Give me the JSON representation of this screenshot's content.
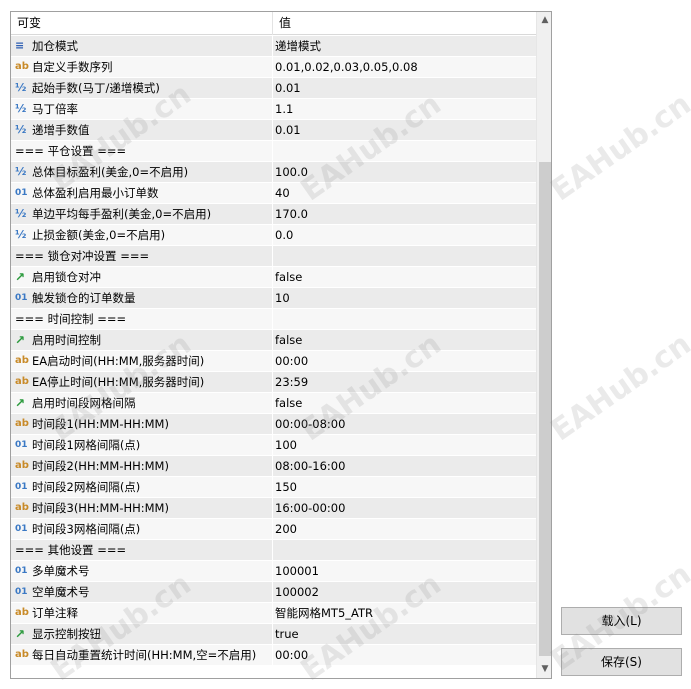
{
  "header": {
    "col_name": "可变",
    "col_value": "值"
  },
  "rows": [
    {
      "type": "enum",
      "icon": "enum-icon",
      "glyph": "≡",
      "name": "加仓模式",
      "value": "递增模式"
    },
    {
      "type": "ab",
      "icon": "string-icon",
      "glyph": "ab",
      "name": "自定义手数序列",
      "value": "0.01,0.02,0.03,0.05,0.08"
    },
    {
      "type": "half",
      "icon": "double-icon",
      "glyph": "½",
      "name": "起始手数(马丁/递增模式)",
      "value": "0.01"
    },
    {
      "type": "half",
      "icon": "double-icon",
      "glyph": "½",
      "name": "马丁倍率",
      "value": "1.1"
    },
    {
      "type": "half",
      "icon": "double-icon",
      "glyph": "½",
      "name": "递增手数值",
      "value": "0.01"
    },
    {
      "type": "section",
      "icon": "",
      "glyph": "",
      "name": "=== 平仓设置 ===",
      "value": ""
    },
    {
      "type": "half",
      "icon": "double-icon",
      "glyph": "½",
      "name": "总体目标盈利(美金,0=不启用)",
      "value": "100.0"
    },
    {
      "type": "int",
      "icon": "integer-icon",
      "glyph": "01",
      "name": "总体盈利启用最小订单数",
      "value": "40"
    },
    {
      "type": "half",
      "icon": "double-icon",
      "glyph": "½",
      "name": "单边平均每手盈利(美金,0=不启用)",
      "value": "170.0"
    },
    {
      "type": "half",
      "icon": "double-icon",
      "glyph": "½",
      "name": "止损金额(美金,0=不启用)",
      "value": "0.0"
    },
    {
      "type": "section",
      "icon": "",
      "glyph": "",
      "name": "=== 锁仓对冲设置 ===",
      "value": ""
    },
    {
      "type": "bool",
      "icon": "bool-icon",
      "glyph": "↗",
      "name": "启用锁仓对冲",
      "value": "false"
    },
    {
      "type": "int",
      "icon": "integer-icon",
      "glyph": "01",
      "name": "触发锁仓的订单数量",
      "value": "10"
    },
    {
      "type": "section",
      "icon": "",
      "glyph": "",
      "name": "=== 时间控制 ===",
      "value": ""
    },
    {
      "type": "bool",
      "icon": "bool-icon",
      "glyph": "↗",
      "name": "启用时间控制",
      "value": "false"
    },
    {
      "type": "ab",
      "icon": "string-icon",
      "glyph": "ab",
      "name": "EA启动时间(HH:MM,服务器时间)",
      "value": "00:00"
    },
    {
      "type": "ab",
      "icon": "string-icon",
      "glyph": "ab",
      "name": "EA停止时间(HH:MM,服务器时间)",
      "value": "23:59"
    },
    {
      "type": "bool",
      "icon": "bool-icon",
      "glyph": "↗",
      "name": "启用时间段网格间隔",
      "value": "false"
    },
    {
      "type": "ab",
      "icon": "string-icon",
      "glyph": "ab",
      "name": "时间段1(HH:MM-HH:MM)",
      "value": "00:00-08:00"
    },
    {
      "type": "int",
      "icon": "integer-icon",
      "glyph": "01",
      "name": "时间段1网格间隔(点)",
      "value": "100"
    },
    {
      "type": "ab",
      "icon": "string-icon",
      "glyph": "ab",
      "name": "时间段2(HH:MM-HH:MM)",
      "value": "08:00-16:00"
    },
    {
      "type": "int",
      "icon": "integer-icon",
      "glyph": "01",
      "name": "时间段2网格间隔(点)",
      "value": "150"
    },
    {
      "type": "ab",
      "icon": "string-icon",
      "glyph": "ab",
      "name": "时间段3(HH:MM-HH:MM)",
      "value": "16:00-00:00"
    },
    {
      "type": "int",
      "icon": "integer-icon",
      "glyph": "01",
      "name": "时间段3网格间隔(点)",
      "value": "200"
    },
    {
      "type": "section",
      "icon": "",
      "glyph": "",
      "name": "=== 其他设置 ===",
      "value": ""
    },
    {
      "type": "int",
      "icon": "integer-icon",
      "glyph": "01",
      "name": "多单魔术号",
      "value": "100001"
    },
    {
      "type": "int",
      "icon": "integer-icon",
      "glyph": "01",
      "name": "空单魔术号",
      "value": "100002"
    },
    {
      "type": "ab",
      "icon": "string-icon",
      "glyph": "ab",
      "name": "订单注释",
      "value": "智能网格MT5_ATR"
    },
    {
      "type": "bool",
      "icon": "bool-icon",
      "glyph": "↗",
      "name": "显示控制按钮",
      "value": "true"
    },
    {
      "type": "ab",
      "icon": "string-icon",
      "glyph": "ab",
      "name": "每日自动重置统计时间(HH:MM,空=不启用)",
      "value": "00:00"
    }
  ],
  "scrollbar": {
    "up_icon": "scroll-up-arrow-icon",
    "down_icon": "scroll-down-arrow-icon"
  },
  "buttons": {
    "load": "载入(L)",
    "save": "保存(S)"
  },
  "watermark": "EAHub.cn"
}
